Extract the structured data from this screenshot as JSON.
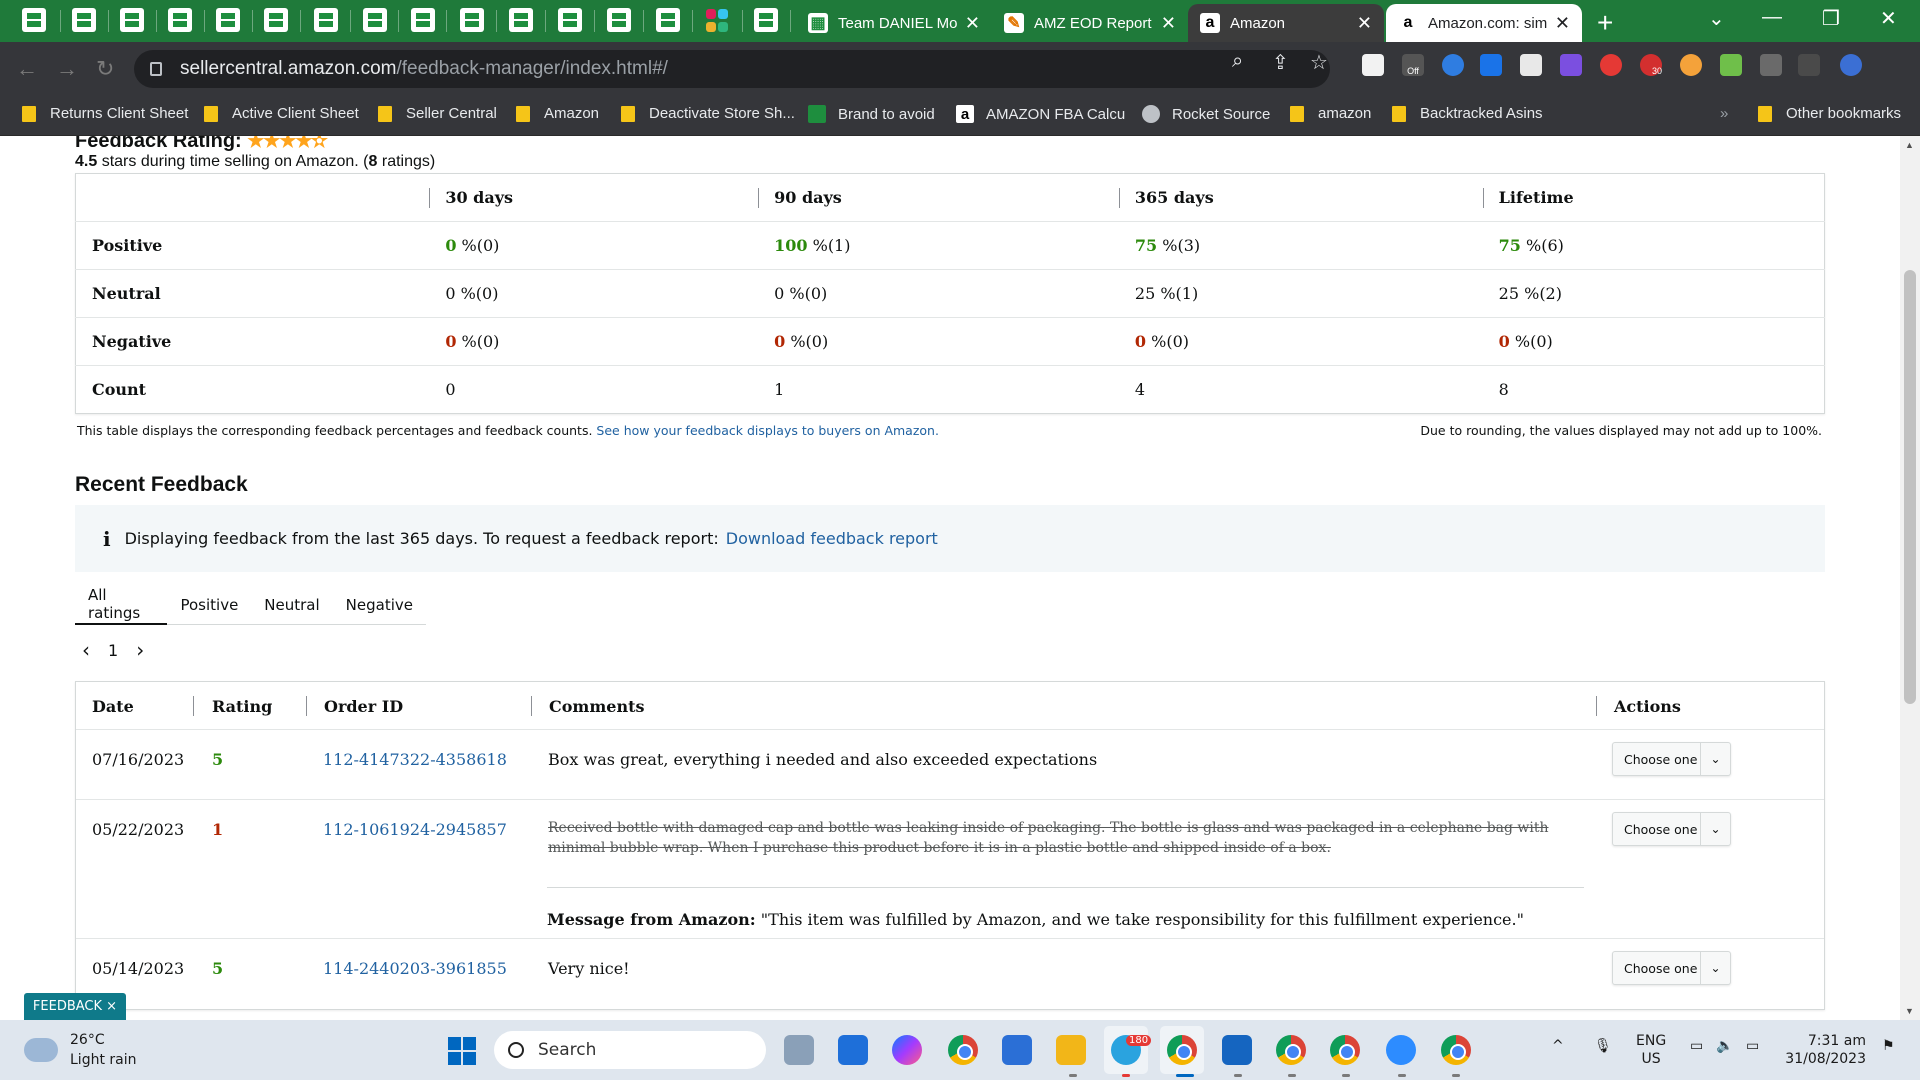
{
  "browser": {
    "tabs": [
      {
        "title": "Team DANIEL Mo",
        "state": "inactive"
      },
      {
        "title": "AMZ EOD Report",
        "state": "inactive"
      },
      {
        "title": "Amazon",
        "state": "dark"
      },
      {
        "title": "Amazon.com: sim",
        "state": "active"
      }
    ],
    "new_tab_label": "+",
    "window_controls": {
      "chevron": "⌄",
      "minimize": "—",
      "maximize": "❐",
      "close": "✕"
    },
    "url_host": "sellercentral.amazon.com",
    "url_path": "/feedback-manager/index.html#/",
    "ext_off_badge": "Off",
    "ext_count_badge": "30",
    "bookmarks": [
      {
        "label": "Returns Client Sheet",
        "icon": "folder-icon"
      },
      {
        "label": "Active Client Sheet",
        "icon": "folder-icon"
      },
      {
        "label": "Seller Central",
        "icon": "folder-icon"
      },
      {
        "label": "Amazon",
        "icon": "folder-icon"
      },
      {
        "label": "Deactivate Store Sh...",
        "icon": "folder-icon"
      },
      {
        "label": "Brand to avoid",
        "icon": "sheets-icon"
      },
      {
        "label": "AMAZON FBA Calcu",
        "icon": "amazon-icon"
      },
      {
        "label": "Rocket Source",
        "icon": "globe-icon"
      },
      {
        "label": "amazon",
        "icon": "folder-icon"
      },
      {
        "label": "Backtracked Asins",
        "icon": "folder-icon"
      }
    ],
    "bookmarks_overflow": "»",
    "other_bookmarks": "Other bookmarks"
  },
  "feedback_rating": {
    "title": "Feedback Rating:",
    "stars_display": "★★★★✫",
    "stars_value": 4.5,
    "subtitle_bold": "4.5",
    "subtitle_mid": "stars during time selling on Amazon. (",
    "subtitle_count": "8",
    "subtitle_end": "ratings)",
    "columns": [
      "30 days",
      "90 days",
      "365 days",
      "Lifetime"
    ],
    "rows": [
      {
        "label": "Positive",
        "cells": [
          {
            "num": "0",
            "rest": "%(0)"
          },
          {
            "num": "100",
            "rest": "%(1)"
          },
          {
            "num": "75",
            "rest": "%(3)"
          },
          {
            "num": "75",
            "rest": "%(6)"
          }
        ]
      },
      {
        "label": "Neutral",
        "cells": [
          {
            "num": "0",
            "rest": "%(0)"
          },
          {
            "num": "0",
            "rest": "%(0)"
          },
          {
            "num": "25",
            "rest": "%(1)"
          },
          {
            "num": "25",
            "rest": "%(2)"
          }
        ]
      },
      {
        "label": "Negative",
        "cells": [
          {
            "num": "0",
            "rest": "%(0)"
          },
          {
            "num": "0",
            "rest": "%(0)"
          },
          {
            "num": "0",
            "rest": "%(0)"
          },
          {
            "num": "0",
            "rest": "%(0)"
          }
        ]
      },
      {
        "label": "Count",
        "cells": [
          {
            "num": "0",
            "rest": ""
          },
          {
            "num": "1",
            "rest": ""
          },
          {
            "num": "4",
            "rest": ""
          },
          {
            "num": "8",
            "rest": ""
          }
        ]
      }
    ],
    "note_left": "This table displays the corresponding feedback percentages and feedback counts.",
    "note_link": "See how your feedback displays to buyers on Amazon.",
    "note_right": "Due to rounding, the values displayed may not add up to 100%."
  },
  "recent_feedback": {
    "title": "Recent Feedback",
    "info_icon": "i",
    "info_text": "Displaying feedback from the last 365 days. To request a feedback report:",
    "info_link": "Download feedback report",
    "filter_tabs": [
      "All ratings",
      "Positive",
      "Neutral",
      "Negative"
    ],
    "selected_tab": "All ratings",
    "pager": {
      "prev": "‹",
      "page": "1",
      "next": "›"
    },
    "columns": {
      "date": "Date",
      "rating": "Rating",
      "order_id": "Order ID",
      "comments": "Comments",
      "actions": "Actions"
    },
    "rows": [
      {
        "date": "07/16/2023",
        "rating": "5",
        "order_id": "112-4147322-4358618",
        "comment": "Box was great, everything i needed and also exceeded expectations",
        "action": "Choose one"
      },
      {
        "date": "05/22/2023",
        "rating": "1",
        "order_id": "112-1061924-2945857",
        "comment": "Received bottle with damaged cap and bottle was leaking inside of packaging. The bottle is glass and was packaged in a celephane bag with minimal bubble wrap. When I purchase this product before it is in a plastic bottle and shipped inside of a box.",
        "message_label": "Message from Amazon:",
        "message": "\"This item was fulfilled by Amazon, and we take responsibility for this fulfillment experience.\"",
        "action": "Choose one"
      },
      {
        "date": "05/14/2023",
        "rating": "5",
        "order_id": "114-2440203-3961855",
        "comment": "Very nice!",
        "action": "Choose one"
      }
    ]
  },
  "feedback_tab": {
    "label": "FEEDBACK",
    "close": "×"
  },
  "taskbar": {
    "weather_temp": "26°C",
    "weather_desc": "Light rain",
    "search_placeholder": "Search",
    "telegram_badge": "180",
    "lang_top": "ENG",
    "lang_bottom": "US",
    "time": "7:31 am",
    "date": "31/08/2023"
  }
}
